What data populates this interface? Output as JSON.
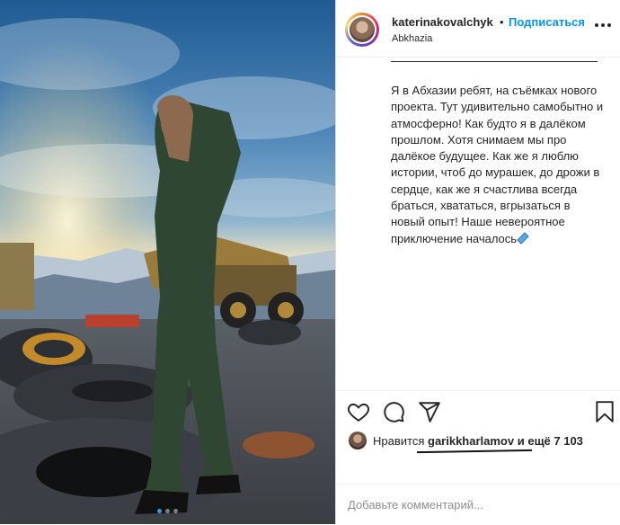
{
  "post": {
    "username": "katerinakovalchyk",
    "separator": "•",
    "follow_label": "Подписаться",
    "location": "Abkhazia",
    "more_icon": "more-horizontal-icon",
    "caption_rule": "______________________________",
    "caption_text": "Я в Абхазии ребят, на съёмках нового проекта. Тут удивительно самобытно и атмосферно! Как будто я в далёком прошлом. Хотя снимаем мы про далёкое будущее. Как же я люблю истории, чтоб до мурашек, до дрожи в сердце, как же я счастлива всегда браться, хвататься, вгрызаться в новый опыт! Наше невероятное приключение началось"
  },
  "actions": {
    "like_icon": "heart-icon",
    "comment_icon": "comment-icon",
    "share_icon": "paper-plane-icon",
    "save_icon": "bookmark-icon"
  },
  "likes": {
    "prefix": "Нравится",
    "user": "garikkharlamov",
    "suffix": "и ещё 7 103"
  },
  "comment": {
    "placeholder": "Добавьте комментарий..."
  },
  "carousel": {
    "count": 3,
    "active_index": 0
  },
  "colors": {
    "accent": "#0095f6",
    "text": "#262626",
    "muted": "#8e8e8e",
    "border": "#dbdbdb"
  }
}
